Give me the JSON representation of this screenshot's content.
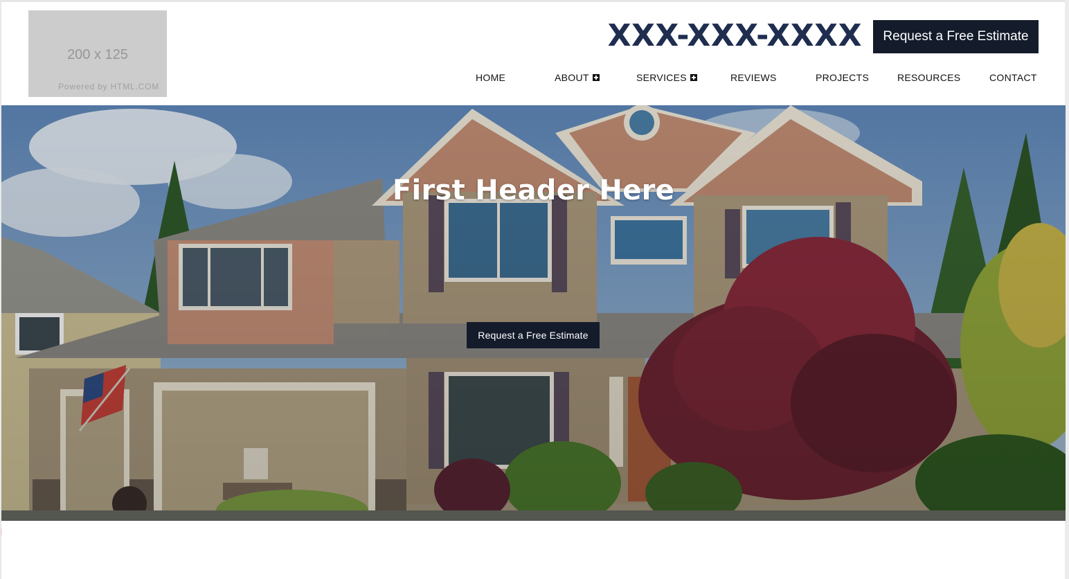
{
  "logo": {
    "size_text": "200 x 125",
    "powered_text": "Powered by HTML.COM"
  },
  "header": {
    "phone": "XXX-XXX-XXXX",
    "cta_label": "Request a Free Estimate"
  },
  "nav": {
    "items": [
      {
        "label": "HOME",
        "icon": null
      },
      {
        "label": "ABOUT",
        "icon": "plus-square-icon"
      },
      {
        "label": "SERVICES",
        "icon": "plus-square-icon"
      },
      {
        "label": "REVIEWS",
        "icon": null
      },
      {
        "label": "PROJECTS",
        "icon": null
      },
      {
        "label": "RESOURCES",
        "icon": null
      },
      {
        "label": "CONTACT",
        "icon": null
      }
    ]
  },
  "hero": {
    "title": "First Header Here",
    "cta_label": "Request a Free Estimate"
  },
  "colors": {
    "phone": "#1f2d4f",
    "button_bg": "#141c2b",
    "button_text": "#ffffff"
  }
}
